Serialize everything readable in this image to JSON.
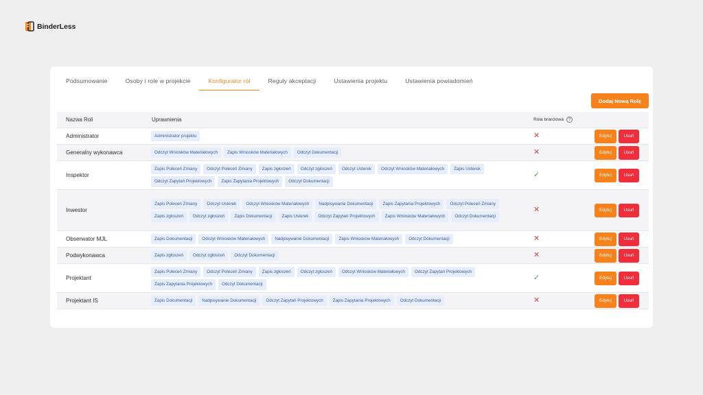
{
  "app": {
    "name": "BinderLess"
  },
  "tabs": [
    {
      "label": "Podsumowanie",
      "active": false
    },
    {
      "label": "Osoby i role w projekcie",
      "active": false
    },
    {
      "label": "Konfigurator ról",
      "active": true
    },
    {
      "label": "Reguły akceptacji",
      "active": false
    },
    {
      "label": "Ustawienia projektu",
      "active": false
    },
    {
      "label": "Ustawienia powiadomień",
      "active": false
    }
  ],
  "add_button": "Dodaj Nową Rolę",
  "table": {
    "headers": {
      "name": "Nazwa Roli",
      "permissions": "Uprawnienia",
      "branch_role": "Rola branżowa",
      "help": "?"
    },
    "edit_label": "Edytuj",
    "delete_label": "Usuń",
    "rows": [
      {
        "name": "Administrator",
        "branch": "✕",
        "branch_ok": false,
        "perms": [
          "Administrator projektu"
        ]
      },
      {
        "name": "Generalny wykonawca",
        "branch": "✕",
        "branch_ok": false,
        "perms": [
          "Odczyt Wniosków Materiałowych",
          "Zapis Wniosków Materiałowych",
          "Odczyt Dokumentacji"
        ]
      },
      {
        "name": "Inspektor",
        "branch": "✓",
        "branch_ok": true,
        "perms": [
          "Zapis Poleceń Zmiany",
          "Odczyt Poleceń Zmiany",
          "Zapis zgłoszeń",
          "Odczyt zgłoszeń",
          "Odczyt Usterek",
          "Odczyt Wniosków Materiałowych",
          "Zapis Usterek",
          "Odczyt Zapytań Projektowych",
          "Zapis Zapytania Projektowych",
          "Odczyt Dokumentacji"
        ]
      },
      {
        "name": "Inwestor",
        "branch": "✕",
        "branch_ok": false,
        "perms": [
          "Zapis Poleceń Zmiany",
          "Odczyt Usterek",
          "Odczyt Wniosków Materiałowych",
          "Nadpisywanie Dokumentacji",
          "Zapis Zapytania Projektowych",
          "Odczyt Poleceń Zmiany",
          "Zapis zgłoszeń",
          "Odczyt zgłoszeń",
          "Zapis Dokumentacji",
          "Zapis Usterek",
          "Odczyt Zapytań Projektowych",
          "Zapis Wniosków Materiałowych",
          "Odczyt Dokumentacji"
        ]
      },
      {
        "name": "Obserwator MJL",
        "branch": "✕",
        "branch_ok": false,
        "perms": [
          "Zapis Dokumentacji",
          "Odczyt Wniosków Materiałowych",
          "Nadpisywanie Dokumentacji",
          "Zapis Wniosków Materiałowych",
          "Odczyt Dokumentacji"
        ]
      },
      {
        "name": "Podwykonawca",
        "branch": "✕",
        "branch_ok": false,
        "perms": [
          "Zapis zgłoszeń",
          "Odczyt zgłoszeń",
          "Odczyt Dokumentacji"
        ]
      },
      {
        "name": "Projektant",
        "branch": "✓",
        "branch_ok": true,
        "perms": [
          "Zapis Poleceń Zmiany",
          "Odczyt Poleceń Zmiany",
          "Zapis zgłoszeń",
          "Odczyt zgłoszeń",
          "Odczyt Wniosków Materiałowych",
          "Odczyt Zapytań Projektowych",
          "Zapis Zapytania Projektowych",
          "Odczyt Dokumentacji"
        ]
      },
      {
        "name": "Projektant IS",
        "branch": "✕",
        "branch_ok": false,
        "perms": [
          "Zapis Dokumentacji",
          "Nadpisywanie Dokumentacji",
          "Odczyt Zapytań Projektowych",
          "Zapis Zapytania Projektowych",
          "Odczyt Dokumentacji"
        ]
      }
    ]
  }
}
